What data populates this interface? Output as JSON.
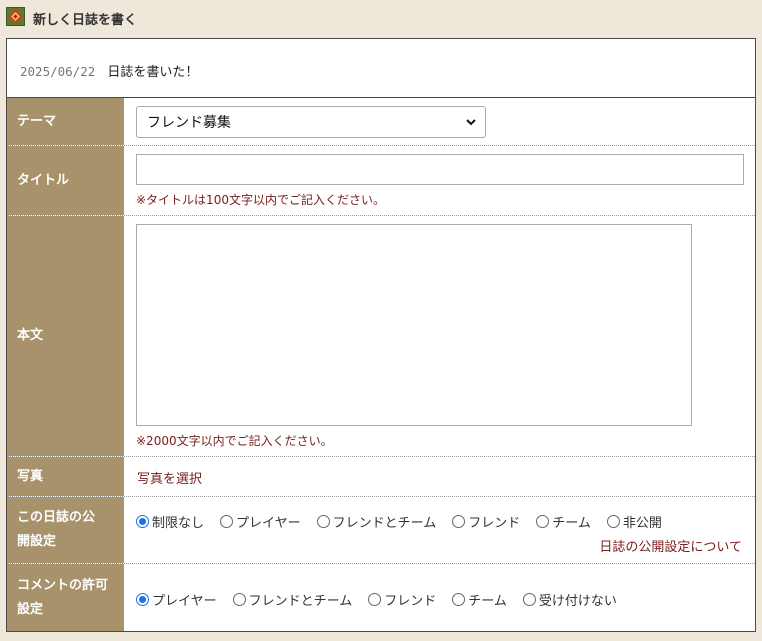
{
  "header": {
    "title": "新しく日誌を書く",
    "icon": "diamond-emblem-icon"
  },
  "entry": {
    "date": "2025/06/22",
    "message": "日誌を書いた！"
  },
  "form": {
    "theme": {
      "label": "テーマ",
      "selected": "フレンド募集"
    },
    "title": {
      "label": "タイトル",
      "value": "",
      "note": "※タイトルは100文字以内でご記入ください。"
    },
    "body": {
      "label": "本文",
      "value": "",
      "note": "※2000文字以内でご記入ください。"
    },
    "photo": {
      "label": "写真",
      "link": "写真を選択"
    },
    "visibility": {
      "label_line1": "この日誌の公",
      "label_line2": "開設定",
      "options": [
        "制限なし",
        "プレイヤー",
        "フレンドとチーム",
        "フレンド",
        "チーム",
        "非公開"
      ],
      "selected_index": 0,
      "help_link": "日誌の公開設定について"
    },
    "comment": {
      "label_line1": "コメントの許可",
      "label_line2": "設定",
      "options": [
        "プレイヤー",
        "フレンドとチーム",
        "フレンド",
        "チーム",
        "受け付けない"
      ],
      "selected_index": 0
    }
  },
  "colors": {
    "label_bg": "#a8926c",
    "note_text": "#7a1d1d",
    "page_bg": "#efe7d9",
    "radio_accent": "#1a73e8"
  }
}
